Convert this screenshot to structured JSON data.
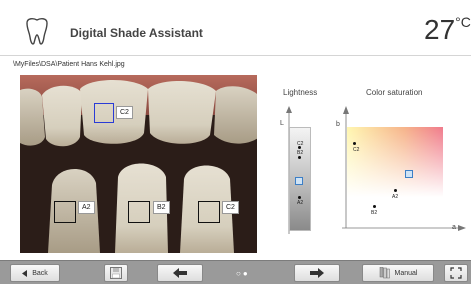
{
  "header": {
    "title": "Digital Shade Assistant",
    "temperature": "27",
    "temperature_unit": "°C"
  },
  "file_path": "\\MyFiles\\DSA\\Patient Hans Kehl.jpg",
  "photo": {
    "selections": [
      {
        "label": "C2",
        "active": true
      },
      {
        "label": "A2",
        "active": false
      },
      {
        "label": "B2",
        "active": false
      },
      {
        "label": "C2",
        "active": false
      }
    ]
  },
  "lightness": {
    "title": "Lightness",
    "axis_label": "L",
    "points": [
      {
        "label": "B2"
      },
      {
        "label": "C2"
      },
      {
        "label": "A2"
      }
    ]
  },
  "saturation": {
    "title": "Color saturation",
    "y_axis_label": "b",
    "x_axis_label": "a",
    "points": [
      {
        "label": "C2"
      },
      {
        "label": "A2"
      },
      {
        "label": "B2"
      }
    ]
  },
  "bottombar": {
    "back_label": "Back",
    "manual_label": "Manual",
    "page_dots": "○●"
  },
  "colors": {
    "accent_blue": "#2a3bd6",
    "marker_blue": "#3d7fc6",
    "bar_gray": "#9a9a9a"
  },
  "icons": [
    "tooth-icon",
    "save-icon",
    "arrow-left-icon",
    "arrow-right-icon",
    "shade-guide-icon",
    "fullscreen-icon"
  ]
}
